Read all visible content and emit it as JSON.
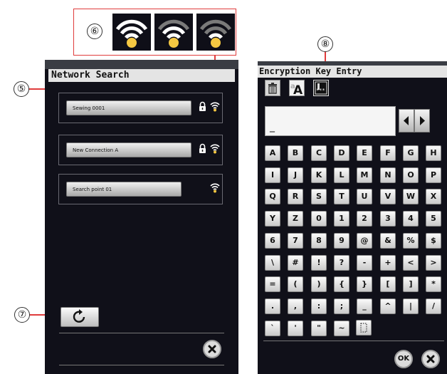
{
  "callouts": {
    "c5": "⑤",
    "c6": "⑥",
    "c7": "⑦",
    "c8": "⑧"
  },
  "network_search": {
    "title": "Network Search",
    "networks": [
      {
        "name": "Sewing 0001",
        "locked": true
      },
      {
        "name": "New Connection A",
        "locked": true
      },
      {
        "name": "Search point 01",
        "locked": false
      }
    ],
    "refresh_icon": "refresh-icon",
    "close_icon": "close-icon"
  },
  "encryption": {
    "title": "Encryption Key Entry",
    "field_value": "_",
    "tools": [
      "trash-icon",
      "case-toggle-icon",
      "mask-icon"
    ],
    "mask_label": "***",
    "keys": [
      [
        "A",
        "B",
        "C",
        "D",
        "E",
        "F",
        "G",
        "H"
      ],
      [
        "I",
        "J",
        "K",
        "L",
        "M",
        "N",
        "O",
        "P"
      ],
      [
        "Q",
        "R",
        "S",
        "T",
        "U",
        "V",
        "W",
        "X"
      ],
      [
        "Y",
        "Z",
        "0",
        "1",
        "2",
        "3",
        "4",
        "5"
      ],
      [
        "6",
        "7",
        "8",
        "9",
        "@",
        "&",
        "%",
        "$"
      ],
      [
        "\\",
        "#",
        "!",
        "?",
        "-",
        "+",
        "<",
        ">"
      ],
      [
        "=",
        "(",
        ")",
        "{",
        "}",
        "[",
        "]",
        "*"
      ],
      [
        ".",
        ",",
        ":",
        ";",
        "_",
        "^",
        "|",
        "/"
      ],
      [
        "`",
        "'",
        "\"",
        "~"
      ]
    ],
    "ok_label": "OK"
  },
  "colors": {
    "screen_bg": "#101019",
    "callout_line": "#e03c3c",
    "wifi": "#f5c842"
  }
}
